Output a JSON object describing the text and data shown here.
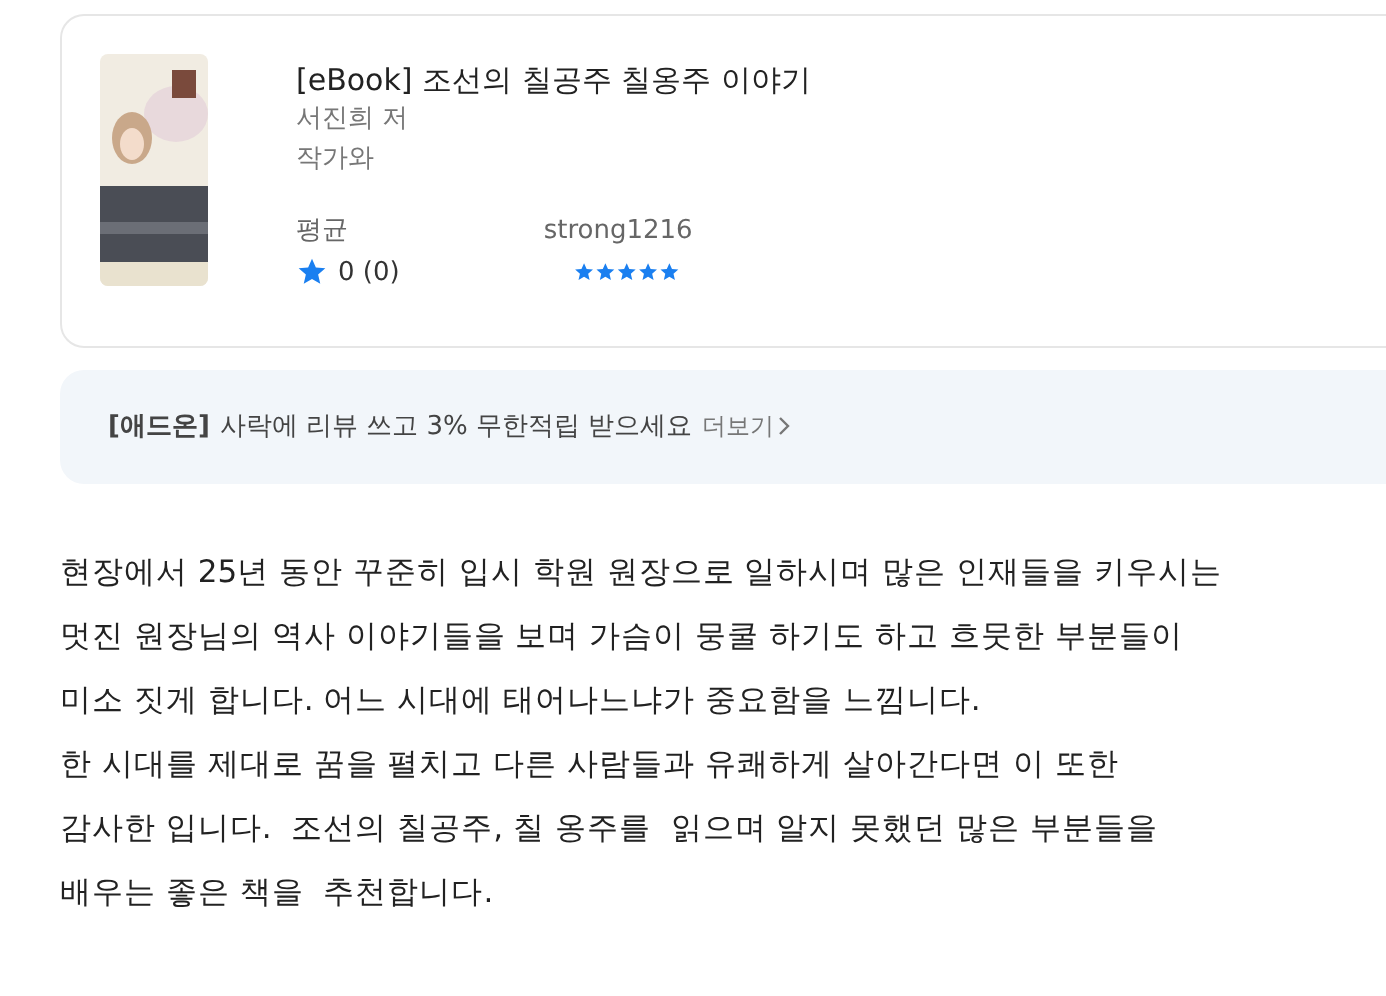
{
  "book": {
    "title": "[eBook] 조선의 칠공주 칠옹주 이야기",
    "author": "서진희 저",
    "publisher": "작가와",
    "average": {
      "label": "평균",
      "score": "0 (0)"
    },
    "reviewer": {
      "name": "strong1216",
      "stars": 5
    }
  },
  "banner": {
    "tag": "[애드온]",
    "message": "사락에 리뷰 쓰고 3% 무한적립 받으세요",
    "link": "더보기"
  },
  "review": [
    "현장에서 25년 동안 꾸준히 입시 학원 원장으로 일하시며 많은 인재들을 키우시는",
    "멋진 원장님의 역사 이야기들을 보며 가슴이 뭉쿨 하기도 하고 흐뭇한 부분들이",
    "미소 짓게 합니다. 어느 시대에 태어나느냐가 중요함을 느낌니다.",
    "한 시대를 제대로 꿈을 펼치고 다른 사람들과 유쾌하게 살아간다면 이 또한",
    "감사한 입니다.  조선의 칠공주, 칠 옹주를  읽으며 알지 못했던 많은 부분들을",
    "배우는 좋은 책을  추천합니다."
  ]
}
